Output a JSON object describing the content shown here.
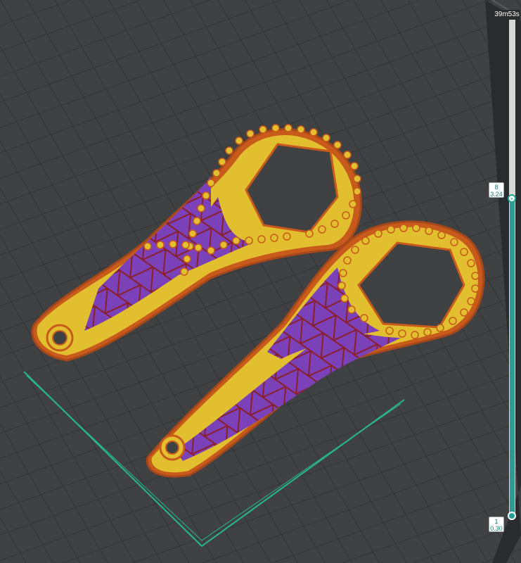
{
  "print_time": "39m53s",
  "layer_slider": {
    "upper": {
      "layer": "8",
      "height": "3.24"
    },
    "lower": {
      "layer": "1",
      "height": "0.30"
    },
    "accent_color": "#22a095"
  },
  "colors": {
    "background": "#3c3d3e",
    "bed_plate": "#404142",
    "grid_line": "#2f3030",
    "bed_boundary": "#27b88a",
    "outer_wall": "#d4621c",
    "inner_wall": "#e2bf2f",
    "infill": "#7a41b8",
    "infill_line": "#8b1e2a"
  }
}
